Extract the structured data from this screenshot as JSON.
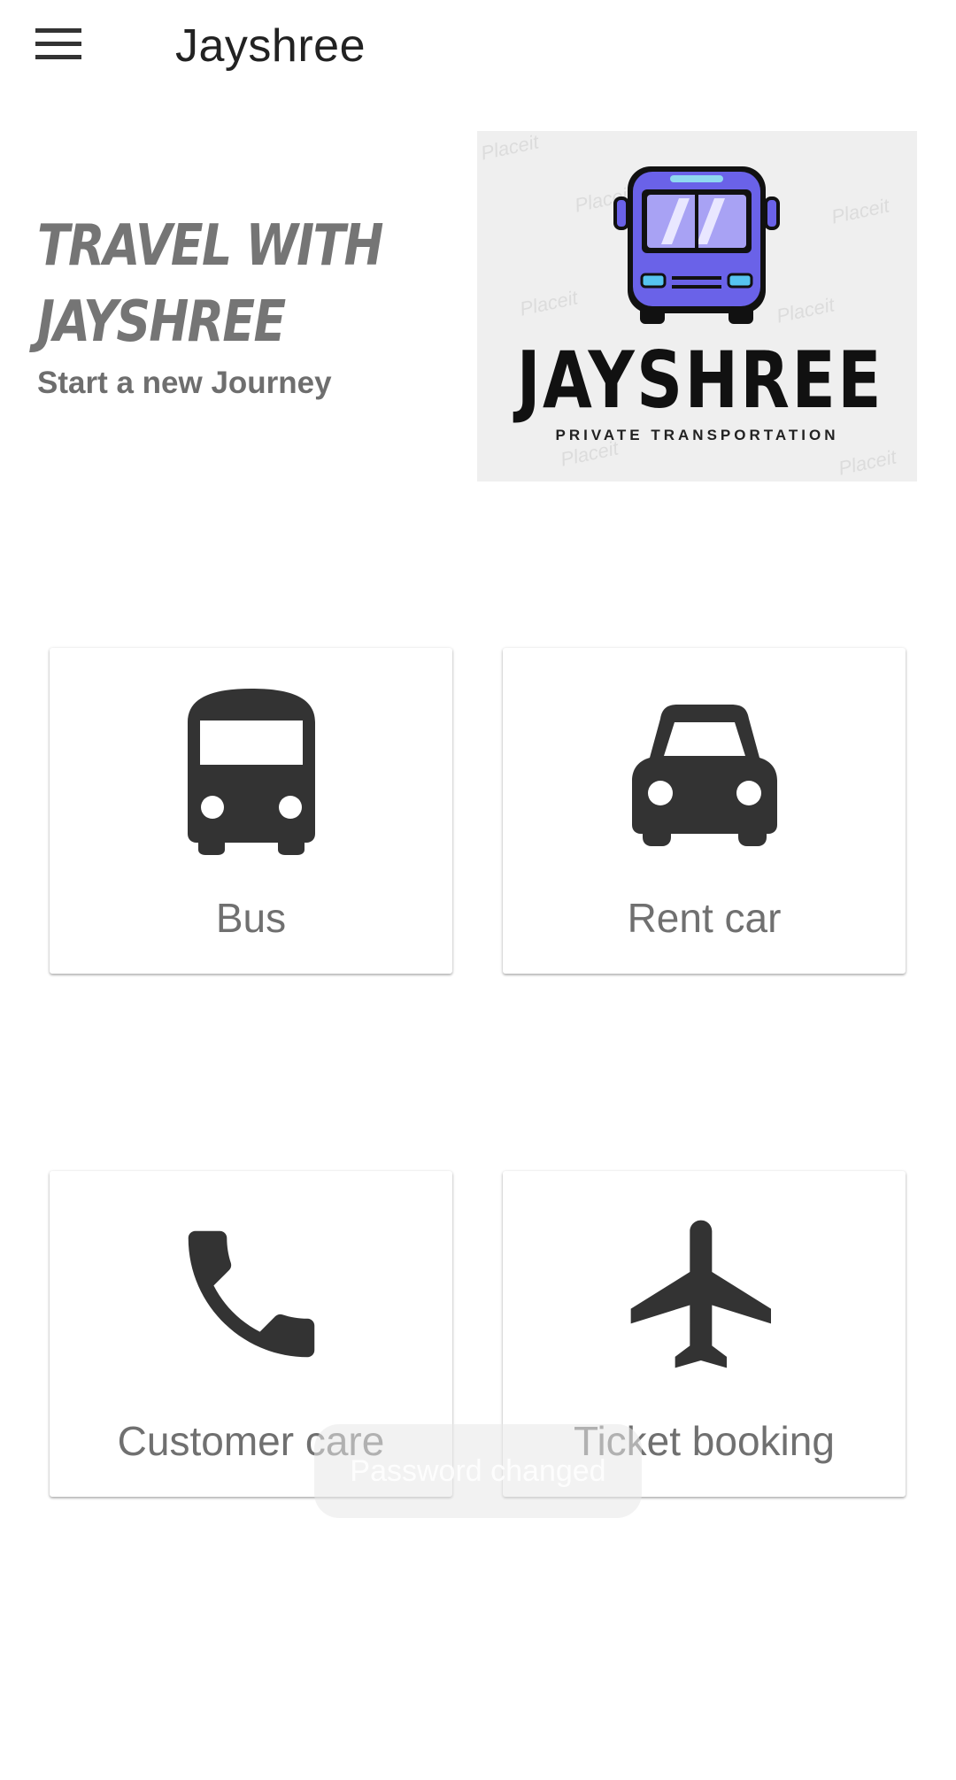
{
  "appbar": {
    "title": "Jayshree",
    "menu_icon": "hamburger-menu-icon"
  },
  "hero": {
    "title_line1": "Travel with",
    "title_line2": "Jayshree",
    "subtitle": "Start a new Journey"
  },
  "logo": {
    "brand": "JAYSHREE",
    "tagline": "PRIVATE TRANSPORTATION",
    "watermark": "Placeit",
    "bus_color": "#6a62e8"
  },
  "tiles": [
    {
      "label": "Bus",
      "icon": "bus-icon"
    },
    {
      "label": "Rent car",
      "icon": "car-icon"
    },
    {
      "label": "Customer care",
      "icon": "phone-icon"
    },
    {
      "label": "Ticket booking",
      "icon": "airplane-icon"
    }
  ],
  "toast": {
    "message": "Password changed"
  },
  "colors": {
    "icon": "#333333",
    "label": "#707070",
    "hero_text": "#757575"
  }
}
